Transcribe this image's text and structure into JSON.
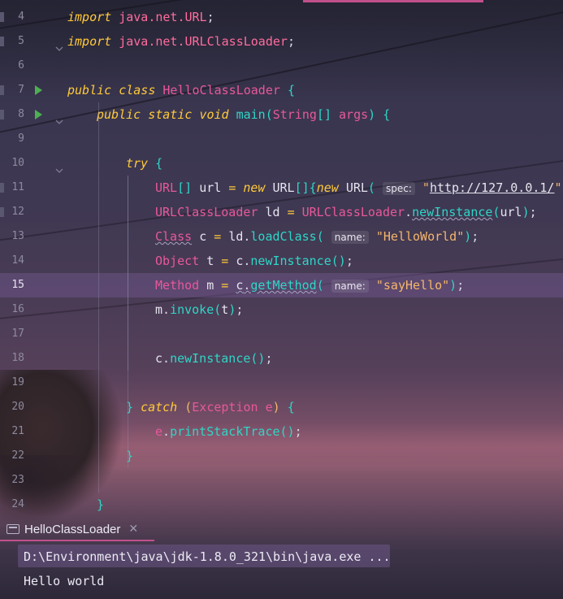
{
  "editor": {
    "lines": [
      {
        "num": "4",
        "tokens": [
          {
            "c": "kw",
            "t": "import"
          },
          {
            "c": "punc",
            "t": " "
          },
          {
            "c": "pkg",
            "t": "java.net.URL"
          },
          {
            "c": "punc",
            "t": ";"
          }
        ]
      },
      {
        "num": "5",
        "tokens": [
          {
            "c": "kw",
            "t": "import"
          },
          {
            "c": "punc",
            "t": " "
          },
          {
            "c": "pkg",
            "t": "java.net.URLClassLoader"
          },
          {
            "c": "punc",
            "t": ";"
          }
        ]
      },
      {
        "num": "6",
        "tokens": []
      },
      {
        "num": "7",
        "run": true,
        "tokens": [
          {
            "c": "kw",
            "t": "public"
          },
          {
            "c": "punc",
            "t": " "
          },
          {
            "c": "kw",
            "t": "class"
          },
          {
            "c": "punc",
            "t": " "
          },
          {
            "c": "typ",
            "t": "HelloClassLoader"
          },
          {
            "c": "punc",
            "t": " "
          },
          {
            "c": "fn",
            "t": "{"
          }
        ]
      },
      {
        "num": "8",
        "run": true,
        "indent": 1,
        "tokens": [
          {
            "c": "kw",
            "t": "public"
          },
          {
            "c": "punc",
            "t": " "
          },
          {
            "c": "kw",
            "t": "static"
          },
          {
            "c": "punc",
            "t": " "
          },
          {
            "c": "kw",
            "t": "void"
          },
          {
            "c": "punc",
            "t": " "
          },
          {
            "c": "fn",
            "t": "main"
          },
          {
            "c": "par",
            "t": "("
          },
          {
            "c": "typ",
            "t": "String"
          },
          {
            "c": "par",
            "t": "[]"
          },
          {
            "c": "punc",
            "t": " "
          },
          {
            "c": "typ",
            "t": "args"
          },
          {
            "c": "par",
            "t": ")"
          },
          {
            "c": "punc",
            "t": " "
          },
          {
            "c": "fn",
            "t": "{"
          }
        ]
      },
      {
        "num": "9",
        "tokens": []
      },
      {
        "num": "10",
        "indent": 2,
        "tokens": [
          {
            "c": "kw",
            "t": "try"
          },
          {
            "c": "punc",
            "t": " "
          },
          {
            "c": "fn",
            "t": "{"
          }
        ]
      },
      {
        "num": "11",
        "indent": 3,
        "tokens": [
          {
            "c": "typ",
            "t": "URL"
          },
          {
            "c": "par",
            "t": "[]"
          },
          {
            "c": "punc",
            "t": " "
          },
          {
            "c": "var",
            "t": "url"
          },
          {
            "c": "punc",
            "t": " "
          },
          {
            "c": "cls",
            "t": "="
          },
          {
            "c": "punc",
            "t": " "
          },
          {
            "c": "kw",
            "t": "new"
          },
          {
            "c": "punc",
            "t": " "
          },
          {
            "c": "var",
            "t": "URL"
          },
          {
            "c": "par",
            "t": "[]"
          },
          {
            "c": "fn",
            "t": "{"
          },
          {
            "c": "kw",
            "t": "new"
          },
          {
            "c": "punc",
            "t": " "
          },
          {
            "c": "var",
            "t": "URL"
          },
          {
            "c": "par",
            "t": "("
          },
          {
            "c": "punc",
            "t": " "
          },
          {
            "c": "hint",
            "t": "spec:"
          },
          {
            "c": "punc",
            "t": " "
          },
          {
            "c": "str",
            "t": "\""
          },
          {
            "c": "url",
            "t": "http://127.0.0.1/"
          },
          {
            "c": "str",
            "t": "\""
          },
          {
            "c": "par",
            "t": ")"
          }
        ]
      },
      {
        "num": "12",
        "indent": 3,
        "tokens": [
          {
            "c": "typ",
            "t": "URLClassLoader"
          },
          {
            "c": "punc",
            "t": " "
          },
          {
            "c": "var",
            "t": "ld"
          },
          {
            "c": "punc",
            "t": " "
          },
          {
            "c": "cls",
            "t": "="
          },
          {
            "c": "punc",
            "t": " "
          },
          {
            "c": "typ",
            "t": "URLClassLoader"
          },
          {
            "c": "punc",
            "t": "."
          },
          {
            "c": "fn squig",
            "t": "newInstance"
          },
          {
            "c": "par",
            "t": "("
          },
          {
            "c": "var",
            "t": "url"
          },
          {
            "c": "par",
            "t": ")"
          },
          {
            "c": "punc",
            "t": ";"
          }
        ]
      },
      {
        "num": "13",
        "indent": 3,
        "tokens": [
          {
            "c": "typ squig",
            "t": "Class"
          },
          {
            "c": "punc",
            "t": " "
          },
          {
            "c": "var",
            "t": "c"
          },
          {
            "c": "punc",
            "t": " "
          },
          {
            "c": "cls",
            "t": "="
          },
          {
            "c": "punc",
            "t": " "
          },
          {
            "c": "var",
            "t": "ld"
          },
          {
            "c": "punc",
            "t": "."
          },
          {
            "c": "fn",
            "t": "loadClass"
          },
          {
            "c": "par",
            "t": "("
          },
          {
            "c": "punc",
            "t": " "
          },
          {
            "c": "hint",
            "t": "name:"
          },
          {
            "c": "punc",
            "t": " "
          },
          {
            "c": "str",
            "t": "\"HelloWorld\""
          },
          {
            "c": "par",
            "t": ")"
          },
          {
            "c": "punc",
            "t": ";"
          }
        ]
      },
      {
        "num": "14",
        "indent": 3,
        "tokens": [
          {
            "c": "typ",
            "t": "Object"
          },
          {
            "c": "punc",
            "t": " "
          },
          {
            "c": "var",
            "t": "t"
          },
          {
            "c": "punc",
            "t": " "
          },
          {
            "c": "cls",
            "t": "="
          },
          {
            "c": "punc",
            "t": " "
          },
          {
            "c": "var",
            "t": "c"
          },
          {
            "c": "punc",
            "t": "."
          },
          {
            "c": "fn",
            "t": "newInstance"
          },
          {
            "c": "par",
            "t": "()"
          },
          {
            "c": "punc",
            "t": ";"
          }
        ]
      },
      {
        "num": "15",
        "current": true,
        "indent": 3,
        "tokens": [
          {
            "c": "typ",
            "t": "Method"
          },
          {
            "c": "punc",
            "t": " "
          },
          {
            "c": "var",
            "t": "m"
          },
          {
            "c": "punc",
            "t": " "
          },
          {
            "c": "cls",
            "t": "="
          },
          {
            "c": "punc",
            "t": " "
          },
          {
            "c": "var squig",
            "t": "c"
          },
          {
            "c": "punc squig",
            "t": "."
          },
          {
            "c": "fn squig",
            "t": "getMethod"
          },
          {
            "c": "par",
            "t": "("
          },
          {
            "c": "punc",
            "t": " "
          },
          {
            "c": "hint",
            "t": "name:"
          },
          {
            "c": "punc",
            "t": " "
          },
          {
            "c": "str",
            "t": "\"sayHello\""
          },
          {
            "c": "par",
            "t": ")"
          },
          {
            "c": "punc",
            "t": ";"
          }
        ]
      },
      {
        "num": "16",
        "indent": 3,
        "tokens": [
          {
            "c": "var",
            "t": "m"
          },
          {
            "c": "punc",
            "t": "."
          },
          {
            "c": "fn",
            "t": "invoke"
          },
          {
            "c": "par",
            "t": "("
          },
          {
            "c": "var",
            "t": "t"
          },
          {
            "c": "par",
            "t": ")"
          },
          {
            "c": "punc",
            "t": ";"
          }
        ]
      },
      {
        "num": "17",
        "tokens": []
      },
      {
        "num": "18",
        "indent": 3,
        "tokens": [
          {
            "c": "var",
            "t": "c"
          },
          {
            "c": "punc",
            "t": "."
          },
          {
            "c": "fn",
            "t": "newInstance"
          },
          {
            "c": "par",
            "t": "()"
          },
          {
            "c": "punc",
            "t": ";"
          }
        ]
      },
      {
        "num": "19",
        "tokens": []
      },
      {
        "num": "20",
        "indent": 2,
        "tokens": [
          {
            "c": "fn",
            "t": "}"
          },
          {
            "c": "punc",
            "t": " "
          },
          {
            "c": "kw",
            "t": "catch"
          },
          {
            "c": "punc",
            "t": " "
          },
          {
            "c": "str",
            "t": "("
          },
          {
            "c": "typ",
            "t": "Exception"
          },
          {
            "c": "punc",
            "t": " "
          },
          {
            "c": "typ",
            "t": "e"
          },
          {
            "c": "str",
            "t": ")"
          },
          {
            "c": "punc",
            "t": " "
          },
          {
            "c": "fn",
            "t": "{"
          }
        ]
      },
      {
        "num": "21",
        "indent": 3,
        "tokens": [
          {
            "c": "typ",
            "t": "e"
          },
          {
            "c": "punc",
            "t": "."
          },
          {
            "c": "fn",
            "t": "printStackTrace"
          },
          {
            "c": "par",
            "t": "()"
          },
          {
            "c": "punc",
            "t": ";"
          }
        ]
      },
      {
        "num": "22",
        "indent": 2,
        "tokens": [
          {
            "c": "fn",
            "t": "}"
          }
        ]
      },
      {
        "num": "23",
        "tokens": []
      },
      {
        "num": "24",
        "indent": 1,
        "tokens": [
          {
            "c": "fn",
            "t": "}"
          }
        ]
      }
    ]
  },
  "run_panel": {
    "tab_label": "HelloClassLoader",
    "tab_icon": "console-icon",
    "close_icon": "close-icon",
    "command_line": "D:\\Environment\\java\\jdk-1.8.0_321\\bin\\java.exe ...",
    "output_line": "Hello world"
  },
  "colors": {
    "keyword": "#ffca3a",
    "type": "#e8589a",
    "function": "#2fd6c6",
    "string": "#f5b66a",
    "accent": "#c0508c",
    "current_line": "#6e5a8c"
  }
}
